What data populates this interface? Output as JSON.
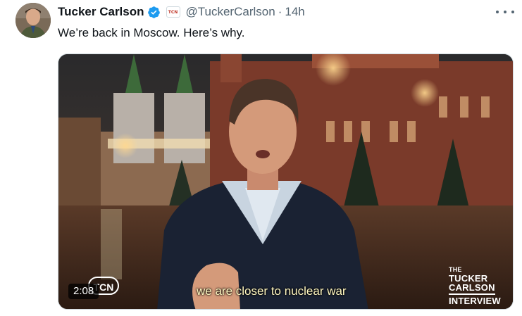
{
  "tweet": {
    "author_name": "Tucker Carlson",
    "author_handle": "@TuckerCarlson",
    "separator": "·",
    "timestamp": "14h",
    "text": "We’re back in Moscow. Here’s why.",
    "affiliation_badge_text": "TCN",
    "verified_color": "#1d9bf0",
    "icons": [
      "verified-badge-icon",
      "affiliation-badge-icon",
      "more-options-icon"
    ]
  },
  "video": {
    "duration": "2:08",
    "network_logo": "TCN",
    "caption": "we are closer to nuclear war",
    "brand_lines": [
      "THE",
      "TUCKER",
      "CARLSON",
      "INTERVIEW"
    ]
  }
}
